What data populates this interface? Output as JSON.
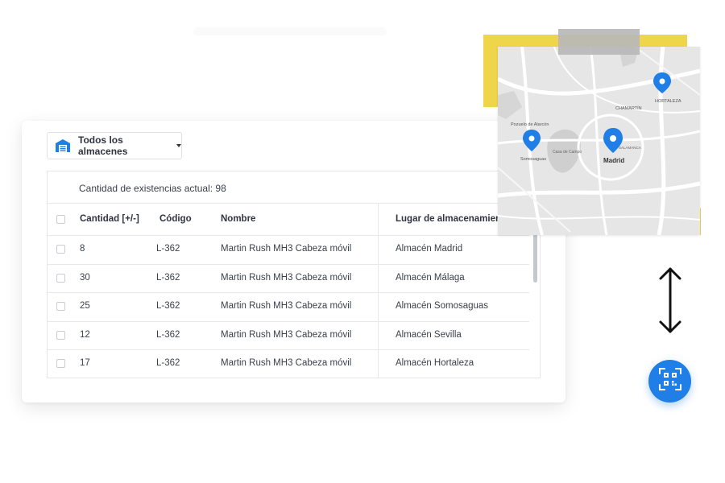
{
  "warehouse_selector": {
    "label": "Todos los almacenes",
    "icon": "warehouse-icon"
  },
  "stock": {
    "summary": "Cantidad de existencias actual: 98"
  },
  "table": {
    "headers": {
      "quantity": "Cantidad [+/-]",
      "code": "Código",
      "name": "Nombre",
      "location": "Lugar de almacenamiento"
    },
    "rows": [
      {
        "quantity": "8",
        "code": "L-362",
        "name": "Martin Rush MH3 Cabeza móvil",
        "location": "Almacén Madrid"
      },
      {
        "quantity": "30",
        "code": "L-362",
        "name": "Martin Rush MH3 Cabeza móvil",
        "location": "Almacén Málaga"
      },
      {
        "quantity": "25",
        "code": "L-362",
        "name": "Martin Rush MH3 Cabeza móvil",
        "location": "Almacén Somosaguas"
      },
      {
        "quantity": "12",
        "code": "L-362",
        "name": "Martin Rush MH3 Cabeza móvil",
        "location": "Almacén Sevilla"
      },
      {
        "quantity": "17",
        "code": "L-362",
        "name": "Martin Rush MH3 Cabeza móvil",
        "location": "Almacén Hortaleza"
      }
    ]
  },
  "map": {
    "labels": {
      "hortaleza": "HORTALEZA",
      "chamartin": "CHAMARTÍN",
      "pozuelo": "Pozuelo de Alarcón",
      "somosaguas": "Somosaguas",
      "madrid": "Madrid",
      "casa_campo": "Casa de Campo",
      "salamanca": "SALAMANCA"
    },
    "pin_color": "#1f7fe6"
  },
  "colors": {
    "accent": "#1f7fe6",
    "note": "#efd54a",
    "tape": "#b8b8b8"
  },
  "actions": {
    "scan_icon": "qr-code-scan-icon",
    "swap_icon": "double-arrow-icon"
  }
}
